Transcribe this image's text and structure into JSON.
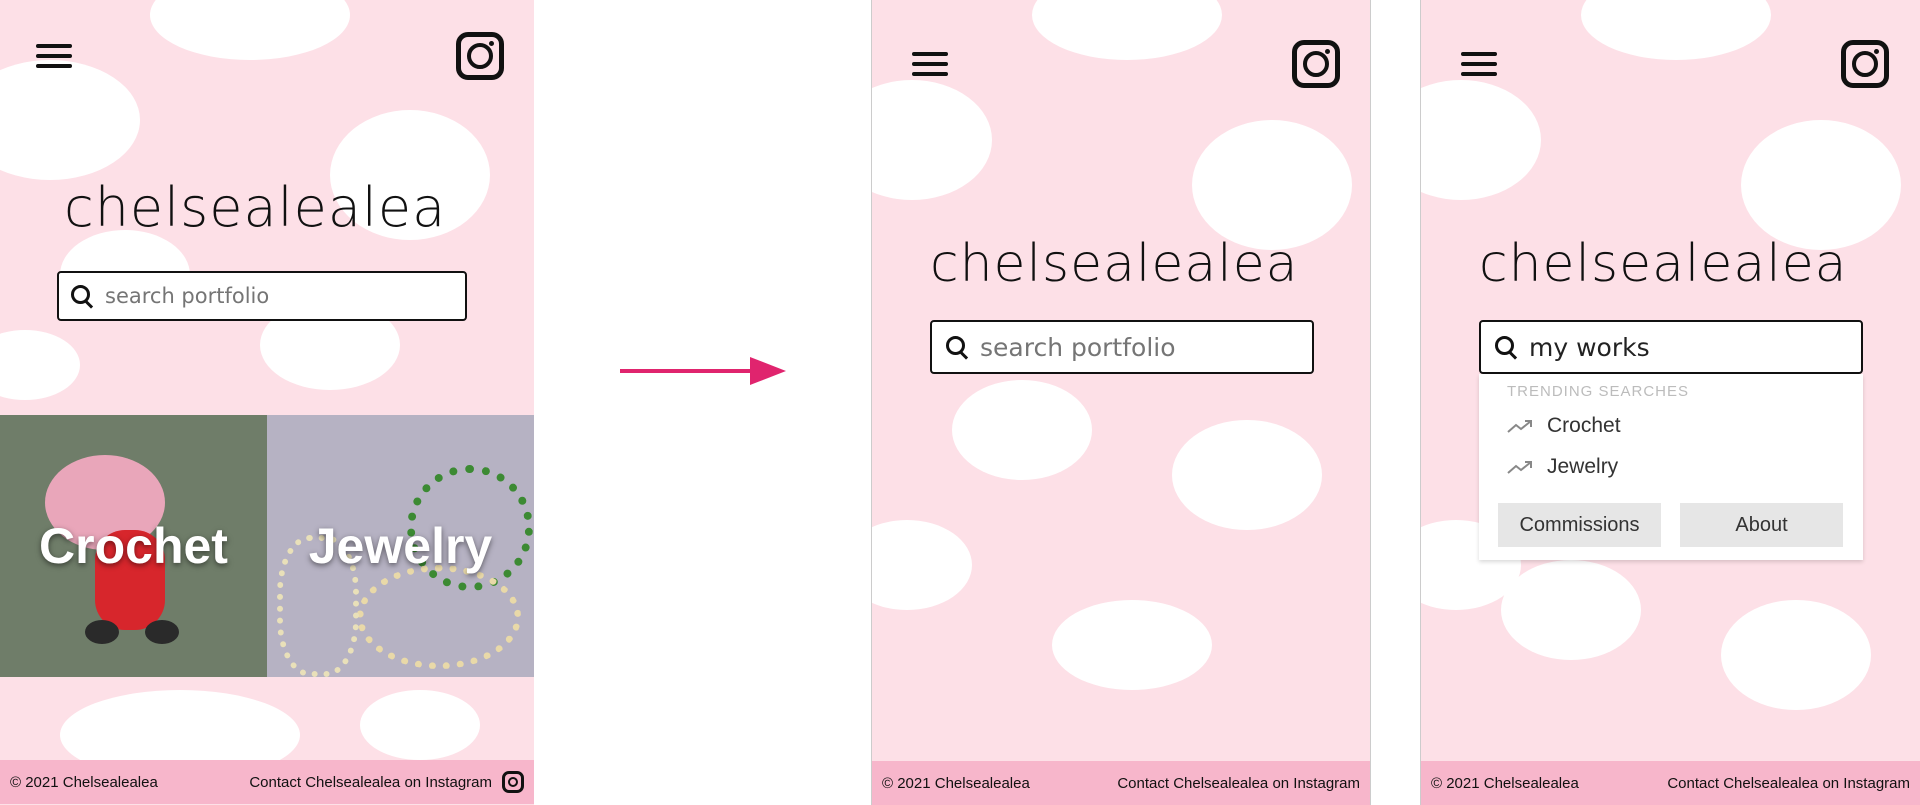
{
  "brand": {
    "name": "chelsealealea"
  },
  "search": {
    "placeholder": "search portfolio",
    "query": "my works"
  },
  "categories": [
    {
      "label": "Crochet"
    },
    {
      "label": "Jewelry"
    }
  ],
  "trending": {
    "heading": "TRENDING SEARCHES",
    "items": [
      {
        "label": "Crochet"
      },
      {
        "label": "Jewelry"
      }
    ]
  },
  "quick_links": [
    {
      "label": "Commissions"
    },
    {
      "label": "About"
    }
  ],
  "footer": {
    "copyright": "© 2021 Chelsealealea",
    "contact": "Contact Chelsealealea on Instagram"
  },
  "icons": [
    "hamburger-menu-icon",
    "instagram-icon",
    "search-icon",
    "trending-icon",
    "arrow-icon"
  ],
  "colors": {
    "pink_bg": "#fde0e7",
    "footer_pink": "#f7b6cb",
    "arrow": "#e0246e"
  }
}
